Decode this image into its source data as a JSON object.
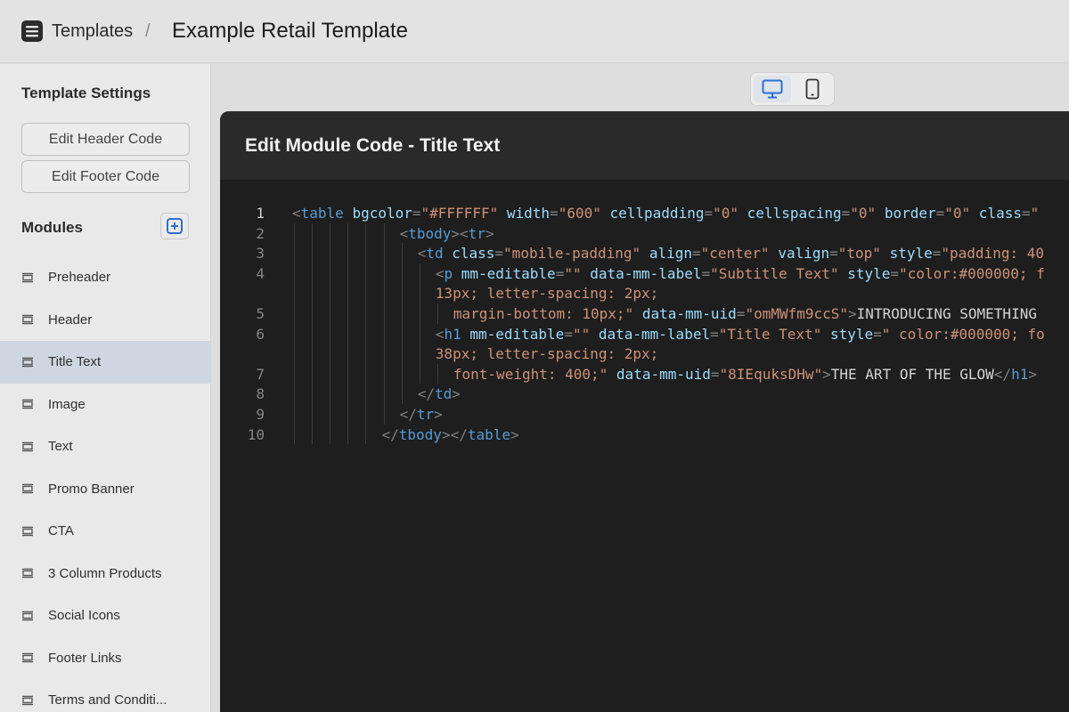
{
  "topbar": {
    "app_icon": "template-stack-icon",
    "breadcrumb_root": "Templates",
    "breadcrumb_separator": "/",
    "page_title": "Example Retail Template"
  },
  "sidebar": {
    "settings_title": "Template Settings",
    "edit_header_label": "Edit Header Code",
    "edit_footer_label": "Edit Footer Code",
    "modules_title": "Modules",
    "add_icon": "plus-square-icon",
    "module_icon": "module-block-icon",
    "modules": [
      {
        "label": "Preheader",
        "active": false
      },
      {
        "label": "Header",
        "active": false
      },
      {
        "label": "Title Text",
        "active": true
      },
      {
        "label": "Image",
        "active": false
      },
      {
        "label": "Text",
        "active": false
      },
      {
        "label": "Promo Banner",
        "active": false
      },
      {
        "label": "CTA",
        "active": false
      },
      {
        "label": "3 Column Products",
        "active": false
      },
      {
        "label": "Social Icons",
        "active": false
      },
      {
        "label": "Footer Links",
        "active": false
      },
      {
        "label": "Terms and Conditi..."
      }
    ]
  },
  "device_toggle": {
    "desktop_icon": "desktop-monitor-icon",
    "mobile_icon": "mobile-phone-icon",
    "selected": "desktop"
  },
  "modal": {
    "title": "Edit Module Code - Title Text",
    "line_numbers": [
      "1",
      "2",
      "3",
      "4",
      "",
      "5",
      "6",
      "",
      "7",
      "8",
      "9",
      "10"
    ],
    "current_line": "1",
    "code_lines": [
      [
        [
          "punc",
          "<"
        ],
        [
          "tag",
          "table"
        ],
        [
          "txt",
          " "
        ],
        [
          "attr",
          "bgcolor"
        ],
        [
          "punc",
          "="
        ],
        [
          "str",
          "\"#FFFFFF\""
        ],
        [
          "txt",
          " "
        ],
        [
          "attr",
          "width"
        ],
        [
          "punc",
          "="
        ],
        [
          "str",
          "\"600\""
        ],
        [
          "txt",
          " "
        ],
        [
          "attr",
          "cellpadding"
        ],
        [
          "punc",
          "="
        ],
        [
          "str",
          "\"0\""
        ],
        [
          "txt",
          " "
        ],
        [
          "attr",
          "cellspacing"
        ],
        [
          "punc",
          "="
        ],
        [
          "str",
          "\"0\""
        ],
        [
          "txt",
          " "
        ],
        [
          "attr",
          "border"
        ],
        [
          "punc",
          "="
        ],
        [
          "str",
          "\"0\""
        ],
        [
          "txt",
          " "
        ],
        [
          "attr",
          "class"
        ],
        [
          "punc",
          "="
        ],
        [
          "str",
          "\""
        ]
      ],
      [
        [
          "punc",
          "<"
        ],
        [
          "tag",
          "tbody"
        ],
        [
          "punc",
          "><"
        ],
        [
          "tag",
          "tr"
        ],
        [
          "punc",
          ">"
        ]
      ],
      [
        [
          "punc",
          "<"
        ],
        [
          "tag",
          "td"
        ],
        [
          "txt",
          " "
        ],
        [
          "attr",
          "class"
        ],
        [
          "punc",
          "="
        ],
        [
          "str",
          "\"mobile-padding\""
        ],
        [
          "txt",
          " "
        ],
        [
          "attr",
          "align"
        ],
        [
          "punc",
          "="
        ],
        [
          "str",
          "\"center\""
        ],
        [
          "txt",
          " "
        ],
        [
          "attr",
          "valign"
        ],
        [
          "punc",
          "="
        ],
        [
          "str",
          "\"top\""
        ],
        [
          "txt",
          " "
        ],
        [
          "attr",
          "style"
        ],
        [
          "punc",
          "="
        ],
        [
          "str",
          "\"padding: 40"
        ]
      ],
      [
        [
          "punc",
          "<"
        ],
        [
          "tag",
          "p"
        ],
        [
          "txt",
          " "
        ],
        [
          "attr",
          "mm-editable"
        ],
        [
          "punc",
          "="
        ],
        [
          "str",
          "\"\""
        ],
        [
          "txt",
          " "
        ],
        [
          "attr",
          "data-mm-label"
        ],
        [
          "punc",
          "="
        ],
        [
          "str",
          "\"Subtitle Text\""
        ],
        [
          "txt",
          " "
        ],
        [
          "attr",
          "style"
        ],
        [
          "punc",
          "="
        ],
        [
          "str",
          "\"color:#000000; f"
        ]
      ],
      [
        [
          "str",
          "13px; letter-spacing: 2px;"
        ]
      ],
      [
        [
          "str",
          "margin-bottom: 10px;\""
        ],
        [
          "txt",
          " "
        ],
        [
          "attr",
          "data-mm-uid"
        ],
        [
          "punc",
          "="
        ],
        [
          "str",
          "\"omMWfm9ccS\""
        ],
        [
          "punc",
          ">"
        ],
        [
          "txt",
          "INTRODUCING SOMETHING"
        ]
      ],
      [
        [
          "punc",
          "<"
        ],
        [
          "tag",
          "h1"
        ],
        [
          "txt",
          " "
        ],
        [
          "attr",
          "mm-editable"
        ],
        [
          "punc",
          "="
        ],
        [
          "str",
          "\"\""
        ],
        [
          "txt",
          " "
        ],
        [
          "attr",
          "data-mm-label"
        ],
        [
          "punc",
          "="
        ],
        [
          "str",
          "\"Title Text\""
        ],
        [
          "txt",
          " "
        ],
        [
          "attr",
          "style"
        ],
        [
          "punc",
          "="
        ],
        [
          "str",
          "\" color:#000000; fo"
        ]
      ],
      [
        [
          "str",
          "38px; letter-spacing: 2px;"
        ]
      ],
      [
        [
          "str",
          "font-weight: 400;\""
        ],
        [
          "txt",
          " "
        ],
        [
          "attr",
          "data-mm-uid"
        ],
        [
          "punc",
          "="
        ],
        [
          "str",
          "\"8IEquksDHw\""
        ],
        [
          "punc",
          ">"
        ],
        [
          "txt",
          "THE ART OF THE GLOW"
        ],
        [
          "punc",
          "</"
        ],
        [
          "tag",
          "h1"
        ],
        [
          "punc",
          ">"
        ]
      ],
      [
        [
          "punc",
          "</"
        ],
        [
          "tag",
          "td"
        ],
        [
          "punc",
          ">"
        ]
      ],
      [
        [
          "punc",
          "</"
        ],
        [
          "tag",
          "tr"
        ],
        [
          "punc",
          ">"
        ]
      ],
      [
        [
          "punc",
          "</"
        ],
        [
          "tag",
          "tbody"
        ],
        [
          "punc",
          "></"
        ],
        [
          "tag",
          "table"
        ],
        [
          "punc",
          ">"
        ]
      ]
    ]
  },
  "colors": {
    "editor_bg": "#1e1e1e",
    "tag": "#569cd6",
    "attribute": "#9cdcfe",
    "string": "#ce9178",
    "punctuation": "#808080",
    "active_module_bg": "#cdd6e1",
    "accent": "#2f6fd1"
  }
}
